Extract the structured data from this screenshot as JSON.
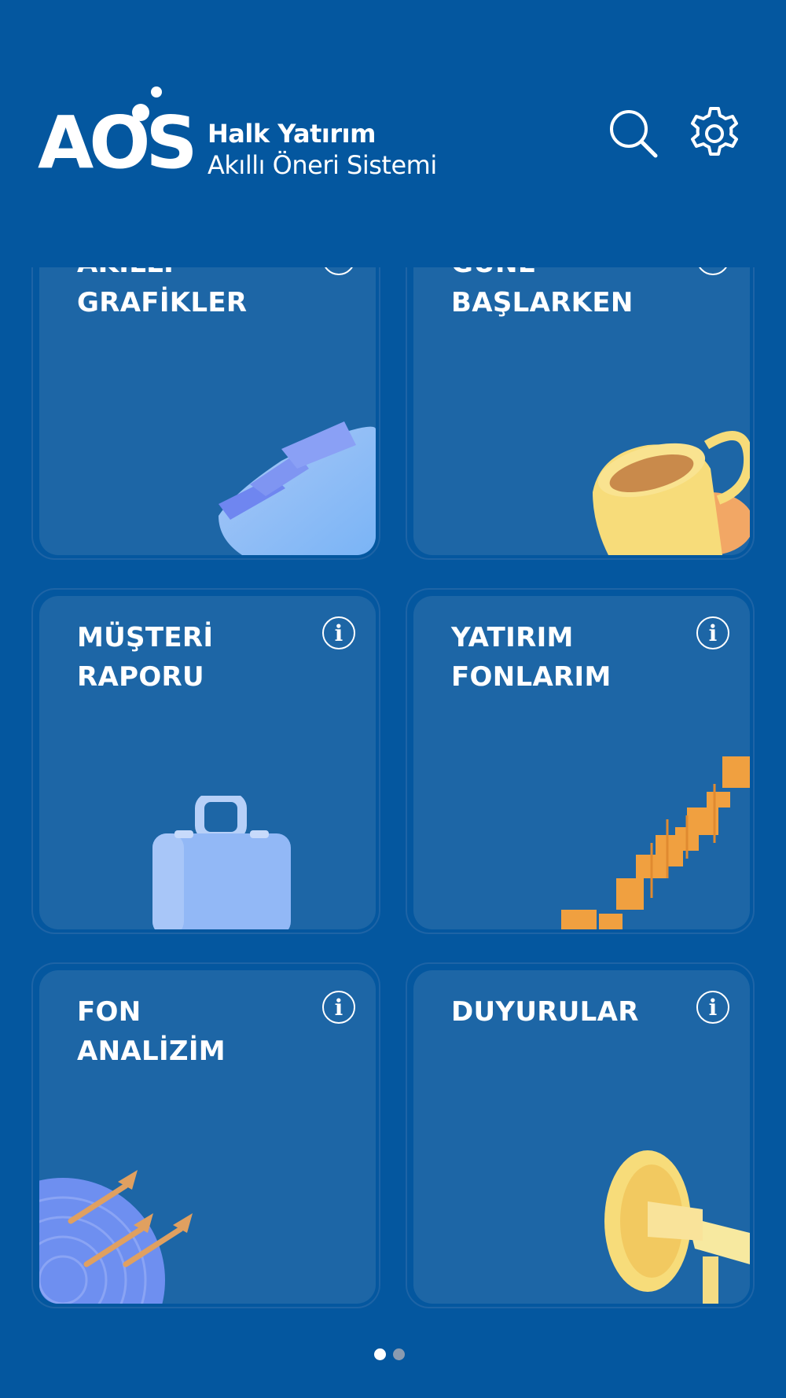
{
  "header": {
    "logo_text": "AOS",
    "brand_name": "Halk Yatırım",
    "brand_subtitle": "Akıllı Öneri Sistemi",
    "search_icon": "search-icon",
    "settings_icon": "gear-icon"
  },
  "tiles": [
    {
      "label": "AKILLI\nGRAFİKLER",
      "info": "i",
      "illustration": "chart-3d-icon"
    },
    {
      "label": "GÜNE\nBAŞLARKEN",
      "info": "i",
      "illustration": "coffee-cup-icon"
    },
    {
      "label": "MÜŞTERİ\nRAPORU",
      "info": "i",
      "illustration": "briefcase-icon"
    },
    {
      "label": "YATIRIM\nFONLARIM",
      "info": "i",
      "illustration": "candlestick-icon"
    },
    {
      "label": "FON\nANALİZİM",
      "info": "i",
      "illustration": "dartboard-icon"
    },
    {
      "label": "DUYURULAR",
      "info": "i",
      "illustration": "megaphone-icon"
    }
  ],
  "pager": {
    "pages": 2,
    "active_page": 1
  },
  "colors": {
    "background": "#04579f",
    "tile": "#1d66a6",
    "accent_orange": "#f0a040",
    "accent_yellow": "#f7dc7a"
  }
}
